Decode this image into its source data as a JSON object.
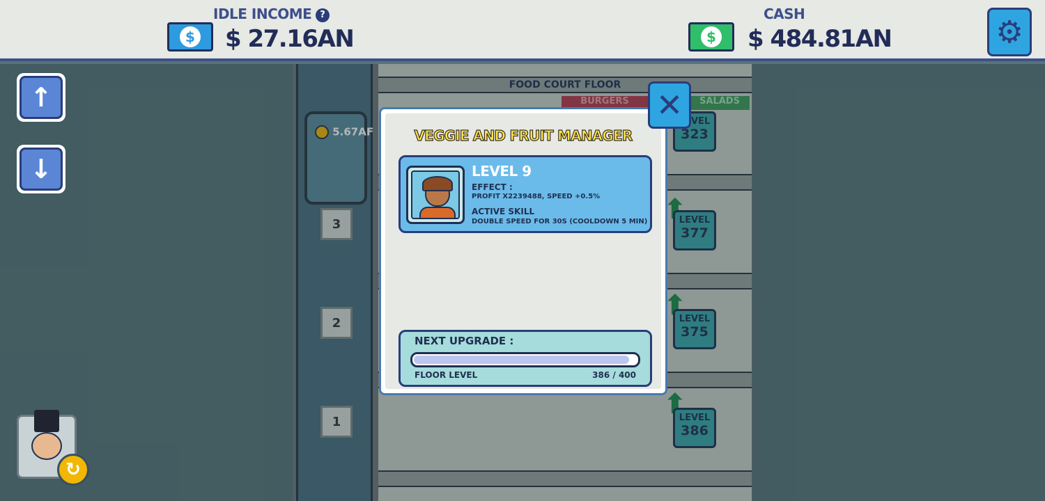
{
  "header": {
    "idle_income_label": "IDLE INCOME",
    "idle_income_value": "$ 27.16AN",
    "cash_label": "CASH",
    "cash_value": "$ 484.81AN",
    "help_icon": "question-icon",
    "settings_icon": "gear-icon"
  },
  "nav": {
    "up_icon": "arrow-up-icon",
    "down_icon": "arrow-down-icon"
  },
  "building": {
    "floor_title": "FOOD COURT FLOOR",
    "shop_labels": [
      "BURGERS",
      "SALADS"
    ],
    "elevator_income": "5.67AF",
    "floor_numbers": [
      "3",
      "2",
      "1"
    ],
    "level_word": "LEVEL",
    "levels": [
      "323",
      "377",
      "375",
      "386"
    ]
  },
  "modal": {
    "title": "VEGGIE AND FRUIT MANAGER",
    "level": "LEVEL 9",
    "effect_label": "EFFECT :",
    "effect_value": "PROFIT X2239488, SPEED +0.5%",
    "skill_label": "ACTIVE SKILL",
    "skill_value": "DOUBLE SPEED FOR 30S (COOLDOWN 5 MIN)",
    "next_upgrade_label": "NEXT UPGRADE :",
    "floor_level_label": "FLOOR LEVEL",
    "floor_level_value": "386 / 400",
    "progress_fraction": 0.965
  },
  "colors": {
    "accent": "#2ea5e0",
    "title": "#ffe84a",
    "cash_green": "#2fbf6a",
    "idle_blue": "#2e9ae0"
  }
}
